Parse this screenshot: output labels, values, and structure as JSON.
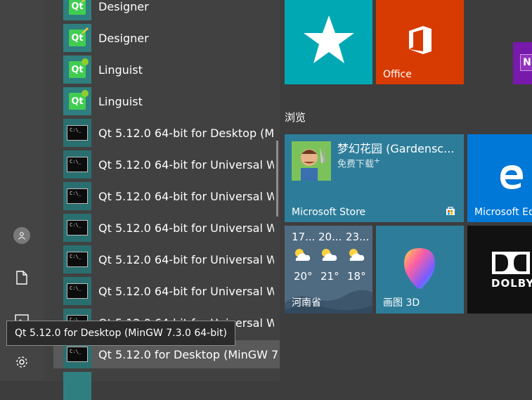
{
  "tooltip": "Qt 5.12.0 for Desktop (MinGW 7.3.0 64-bit)",
  "rail": {
    "items": [
      {
        "icon": "user-icon"
      },
      {
        "icon": "document-icon"
      },
      {
        "icon": "pictures-icon"
      },
      {
        "icon": "gear-icon"
      }
    ]
  },
  "apps": [
    {
      "label": "Designer",
      "icon": "qt-designer-icon"
    },
    {
      "label": "Designer",
      "icon": "qt-designer-icon"
    },
    {
      "label": "Linguist",
      "icon": "qt-linguist-icon"
    },
    {
      "label": "Linguist",
      "icon": "qt-linguist-icon"
    },
    {
      "label": "Qt 5.12.0 64-bit for Desktop (M...",
      "icon": "cmd-icon"
    },
    {
      "label": "Qt 5.12.0 64-bit for Universal W...",
      "icon": "cmd-icon"
    },
    {
      "label": "Qt 5.12.0 64-bit for Universal W...",
      "icon": "cmd-icon"
    },
    {
      "label": "Qt 5.12.0 64-bit for Universal W...",
      "icon": "cmd-icon"
    },
    {
      "label": "Qt 5.12.0 64-bit for Universal W...",
      "icon": "cmd-icon"
    },
    {
      "label": "Qt 5.12.0 64-bit for Universal W...",
      "icon": "cmd-icon"
    },
    {
      "label": "Qt 5.12.0 64-bit for Universal W...",
      "icon": "cmd-icon"
    },
    {
      "label": "Qt 5.12.0 for Desktop (MinGW 7...",
      "icon": "cmd-icon"
    }
  ],
  "cmd_text": "C:\\_",
  "qt_text": "Qt",
  "tiles": {
    "favorites": {
      "label": "",
      "color": "#00a8b4"
    },
    "office": {
      "label": "Office",
      "color": "#d83b01"
    },
    "onenote": {
      "letter": "N",
      "color": "#7719aa"
    },
    "group_title": "浏览",
    "store": {
      "app_title": "梦幻花园 (Gardensc...",
      "sub": "免费下载",
      "sub_mark": "+",
      "label": "Microsoft Store",
      "color": "#2d7d9a"
    },
    "edge": {
      "label": "Microsoft Ed",
      "color": "#0078d7"
    },
    "weather": {
      "label": "河南省",
      "days": [
        {
          "top": "17...",
          "temp": "20°"
        },
        {
          "top": "20...",
          "temp": "21°"
        },
        {
          "top": "23...",
          "temp": "18°"
        }
      ]
    },
    "paint3d": {
      "label": "画图 3D",
      "color": "#2d7d9a"
    },
    "dolby": {
      "label": "DOLBY",
      "color": "#111111"
    }
  }
}
